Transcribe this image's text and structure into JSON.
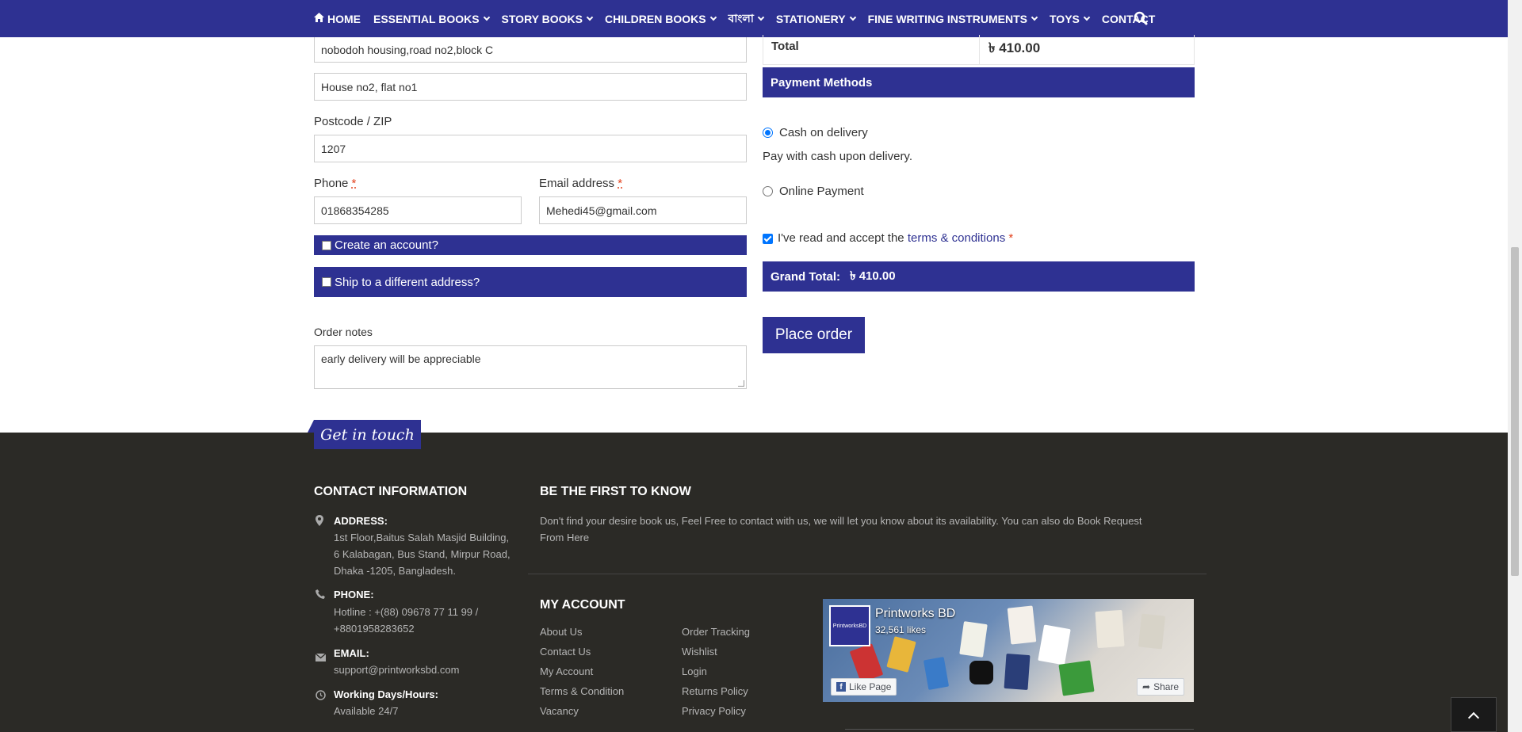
{
  "nav": {
    "items": [
      {
        "label": "HOME",
        "has_icon": true
      },
      {
        "label": "ESSENTIAL BOOKS",
        "dropdown": true
      },
      {
        "label": "STORY BOOKS",
        "dropdown": true
      },
      {
        "label": "CHILDREN BOOKS",
        "dropdown": true
      },
      {
        "label": "বাংলা",
        "dropdown": true
      },
      {
        "label": "STATIONERY",
        "dropdown": true
      },
      {
        "label": "FINE WRITING INSTRUMENTS",
        "dropdown": true
      },
      {
        "label": "TOYS",
        "dropdown": true
      },
      {
        "label": "CONTACT",
        "dropdown": false
      }
    ],
    "color": "#2e3192"
  },
  "form": {
    "street_line1": "nobodoh housing,road no2,block C",
    "street_line2": "House no2, flat no1",
    "postcode_label": "Postcode / ZIP",
    "postcode": "1207",
    "phone_label": "Phone",
    "phone": "01868354285",
    "email_label": "Email address",
    "email": "Mehedi45@gmail.com",
    "required_mark": "*",
    "create_account": "Create an account?",
    "ship_different": "Ship to a different address?",
    "order_notes_label": "Order notes",
    "order_notes": "early delivery will be appreciable"
  },
  "order": {
    "total_label": "Total",
    "total_value": "৳ 410.00",
    "payment_methods": "Payment Methods",
    "cod_label": "Cash on delivery",
    "cod_desc": "Pay with cash upon delivery.",
    "online_label": "Online Payment",
    "terms_prefix": "I've read and accept the",
    "terms_link": "terms & conditions",
    "terms_req": "*",
    "grand_total_label": "Grand Total:",
    "grand_total_value": "৳ 410.00",
    "place_order": "Place order"
  },
  "footer": {
    "tab": "Get in touch",
    "contact_heading": "CONTACT INFORMATION",
    "address_label": "ADDRESS:",
    "address_lines": [
      "1st Floor,Baitus Salah Masjid Building,",
      "6 Kalabagan, Bus Stand, Mirpur Road,",
      "Dhaka -1205, Bangladesh."
    ],
    "phone_label": "PHONE:",
    "phone_lines": [
      "Hotline : +(88) 09678 77 11 99 /",
      "+8801958283652"
    ],
    "email_label": "EMAIL:",
    "email": "support@printworksbd.com",
    "hours_label": "Working Days/Hours:",
    "hours": "Available 24/7",
    "know_heading": "BE THE FIRST TO KNOW",
    "know_lines": [
      "Don't find your desire book us, Feel Free to contact with us, we will let you know about its availability. You can also do Book Request",
      "From Here"
    ],
    "account_heading": "MY ACCOUNT",
    "links_col1": [
      "About Us",
      "Contact Us",
      "My Account",
      "Terms & Condition",
      "Vacancy"
    ],
    "links_col2": [
      "Order Tracking",
      "Wishlist",
      "Login",
      "Returns Policy",
      "Privacy Policy"
    ],
    "fb": {
      "name": "Printworks BD",
      "likes": "32,561 likes",
      "logo_text": "PrintworksBD",
      "like_btn": "Like Page",
      "share_btn": "Share"
    }
  },
  "icons": {
    "home": "home-icon",
    "search": "search-icon",
    "location": "map-marker-icon",
    "phone": "phone-icon",
    "email": "envelope-icon",
    "clock": "clock-icon",
    "back_to_top": "chevron-up-icon"
  }
}
